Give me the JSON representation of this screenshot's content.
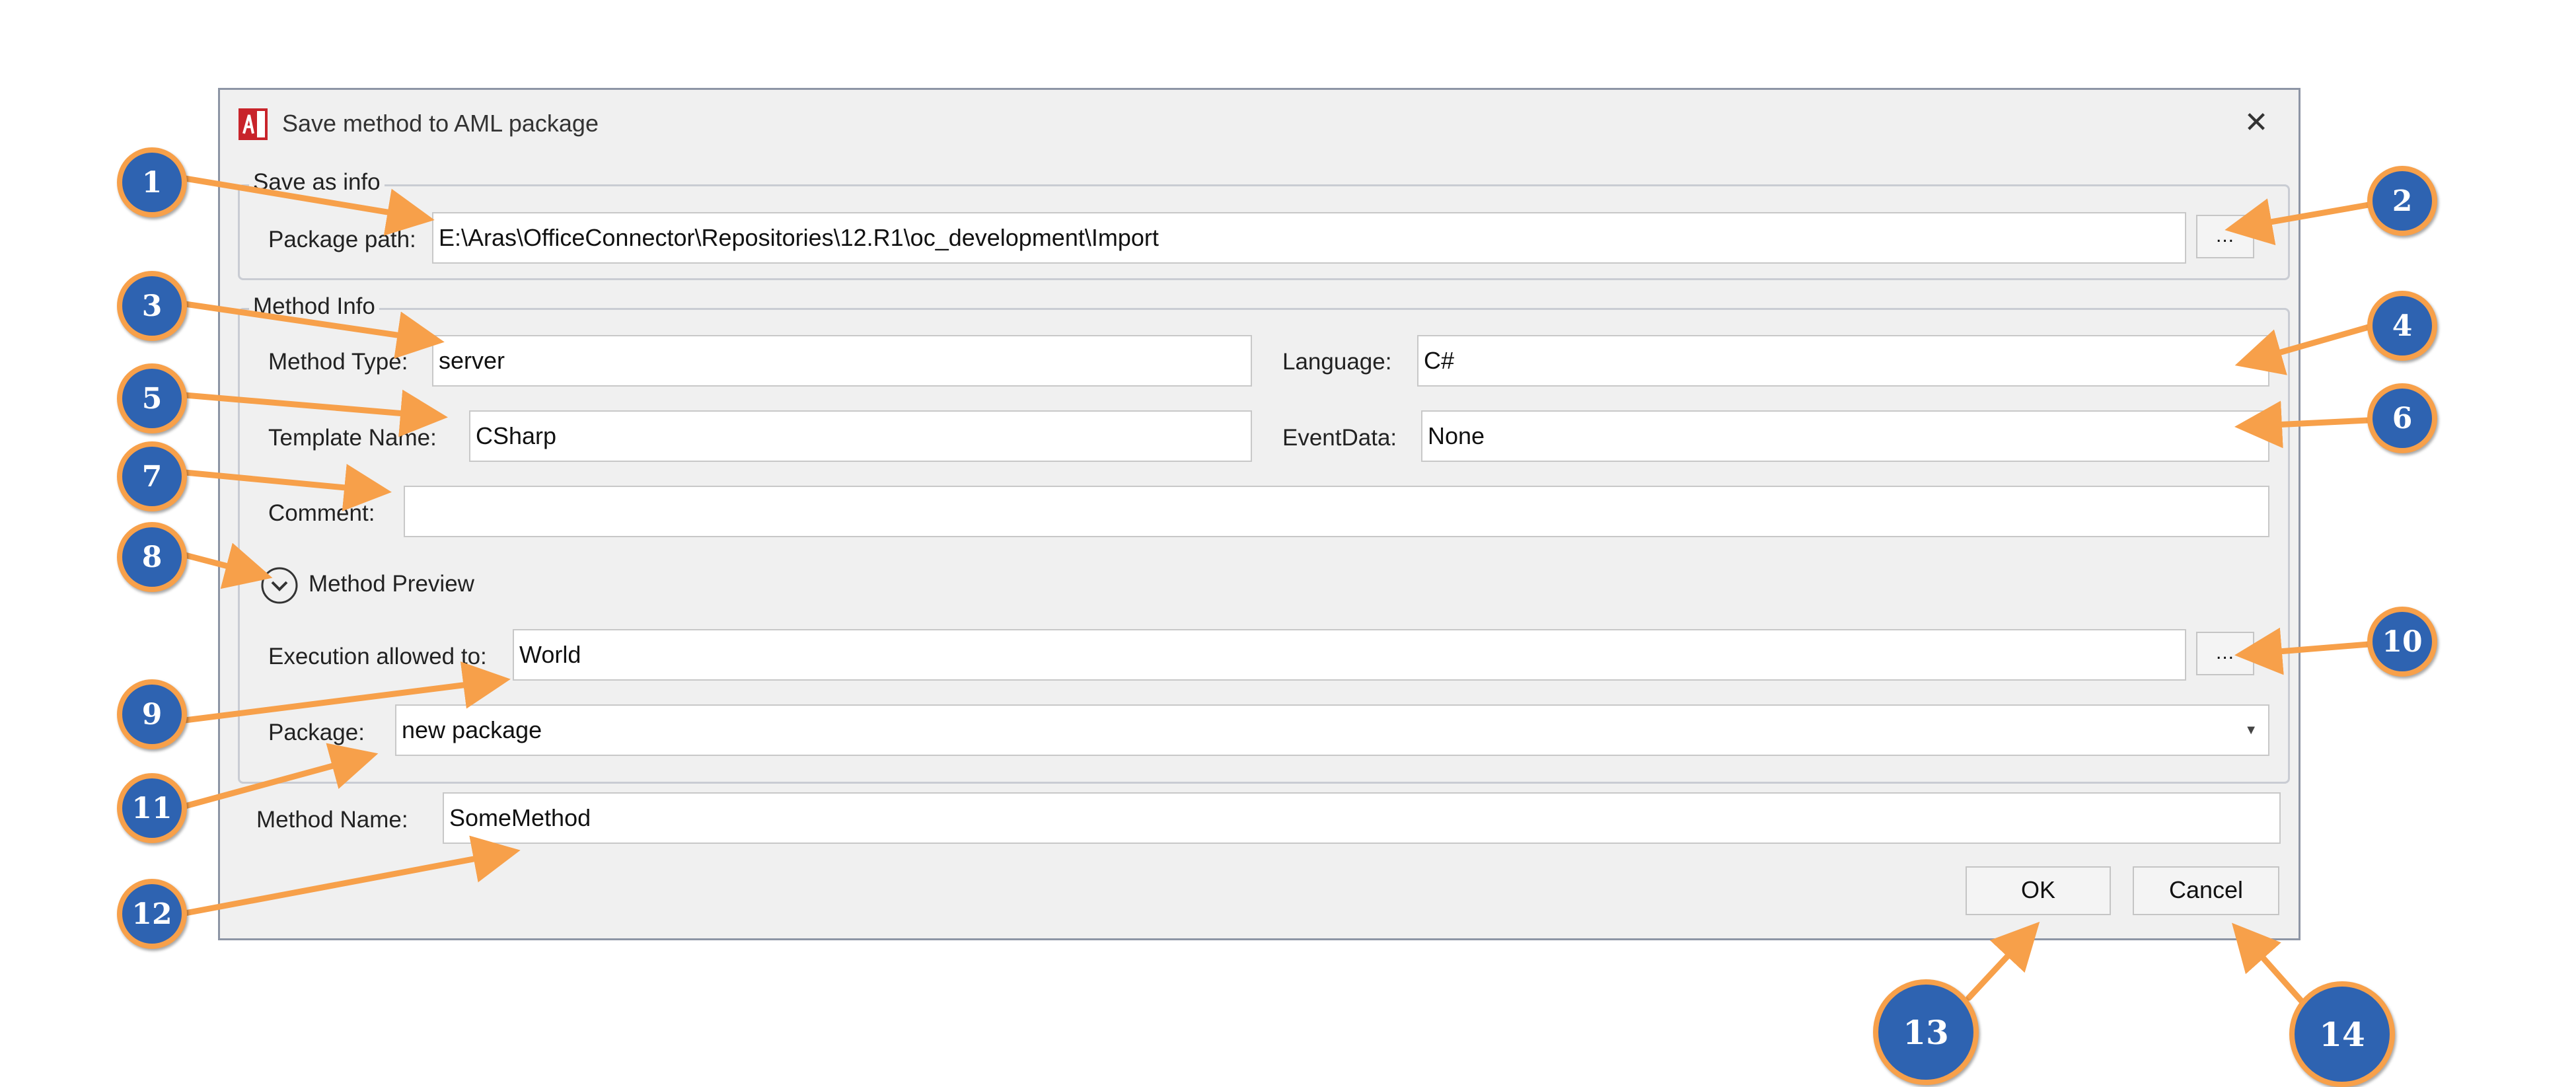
{
  "window": {
    "title": "Save method to AML package",
    "close_glyph": "✕",
    "app_icon": "aras-app-icon"
  },
  "save_as_info": {
    "group_label": "Save as info",
    "package_path_label": "Package path:",
    "package_path_value": "E:\\Aras\\OfficeConnector\\Repositories\\12.R1\\oc_development\\Import",
    "browse_label": "..."
  },
  "method_info": {
    "group_label": "Method Info",
    "method_type_label": "Method Type:",
    "method_type_value": "server",
    "language_label": "Language:",
    "language_value": "C#",
    "template_name_label": "Template Name:",
    "template_name_value": "CSharp",
    "event_data_label": "EventData:",
    "event_data_value": "None",
    "comment_label": "Comment:",
    "comment_value": "",
    "method_preview_label": "Method Preview",
    "execution_label": "Execution allowed to:",
    "execution_value": "World",
    "execution_browse_label": "...",
    "package_label": "Package:",
    "package_value": "new package"
  },
  "method_name": {
    "label": "Method Name:",
    "value": "SomeMethod"
  },
  "buttons": {
    "ok": "OK",
    "cancel": "Cancel"
  },
  "callouts": [
    "1",
    "2",
    "3",
    "4",
    "5",
    "6",
    "7",
    "8",
    "9",
    "10",
    "11",
    "12",
    "13",
    "14"
  ],
  "colors": {
    "callout_fill": "#2e63b1",
    "callout_ring": "#f7a04a",
    "arrow": "#f7a04a",
    "dialog_bg": "#f0f0f0"
  }
}
